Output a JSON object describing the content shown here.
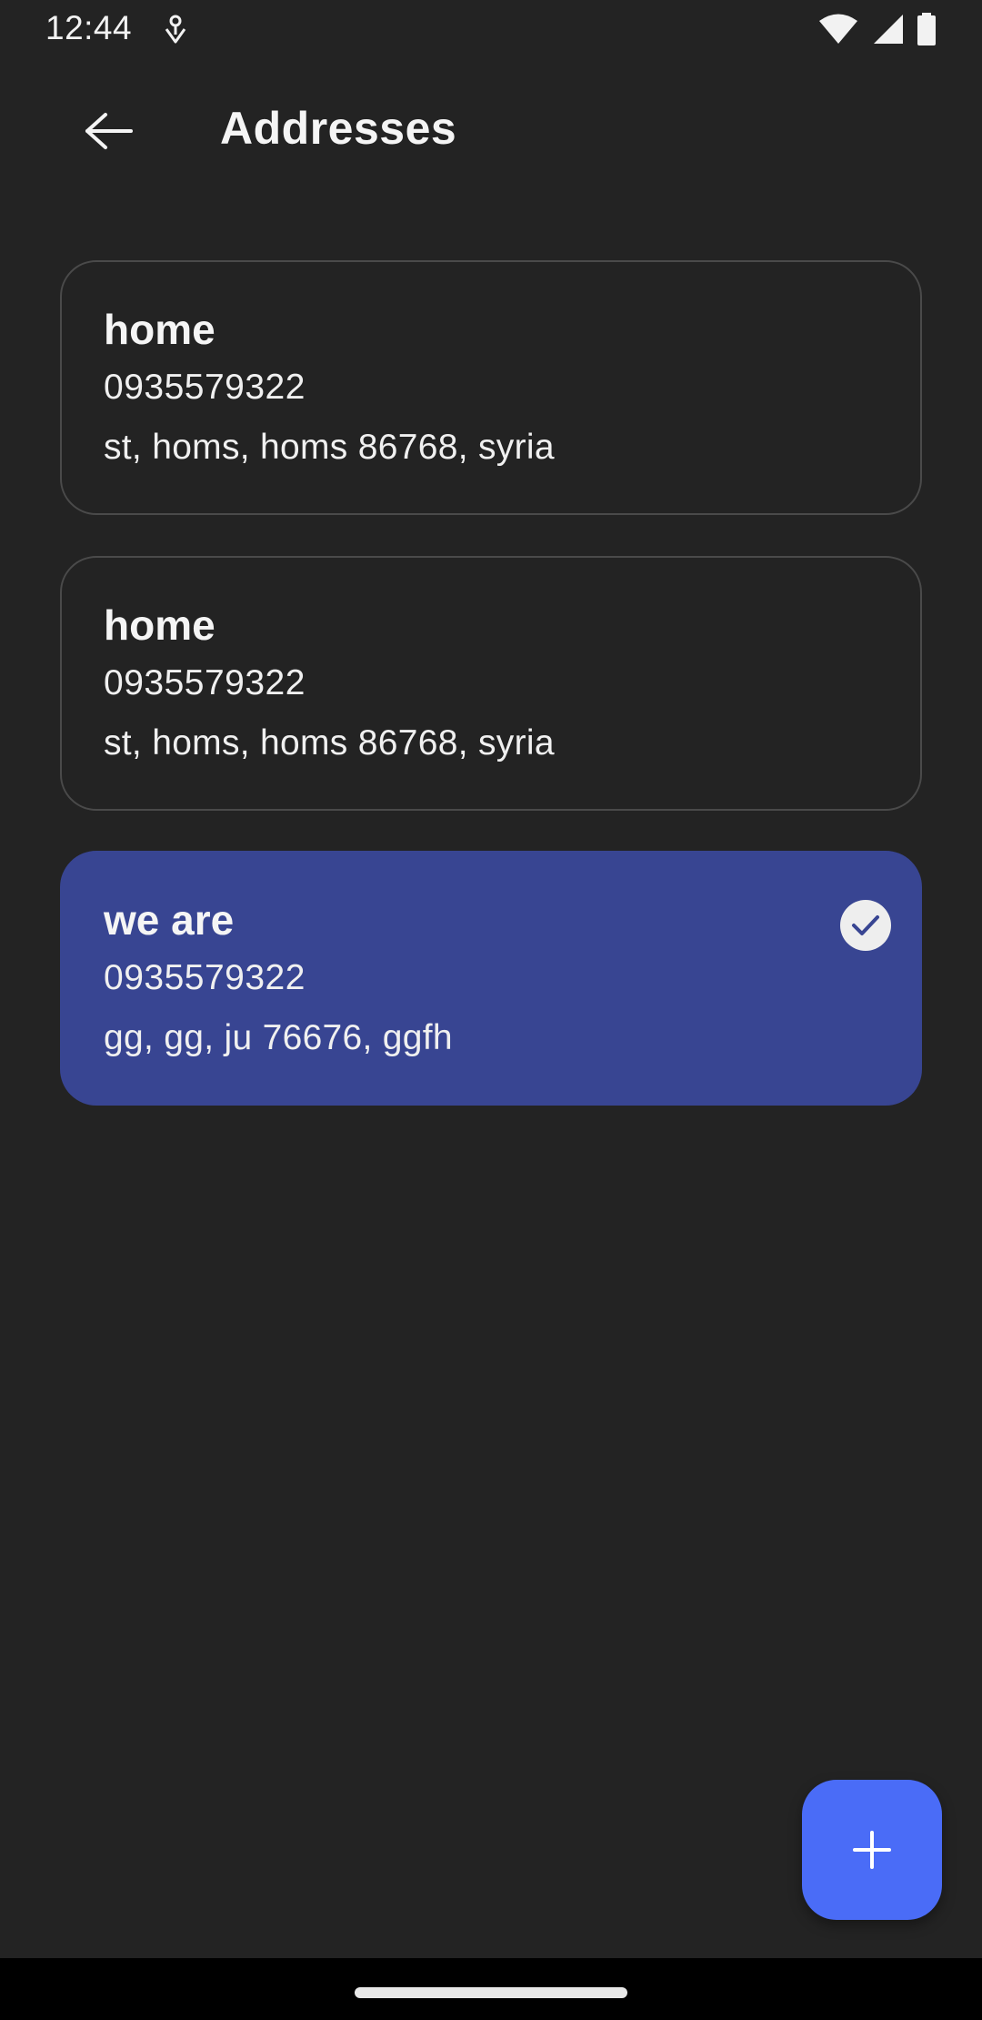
{
  "status_bar": {
    "time": "12:44"
  },
  "header": {
    "title": "Addresses"
  },
  "addresses": [
    {
      "name": "home",
      "phone": "0935579322",
      "address": "st, homs, homs 86768, syria",
      "selected": false
    },
    {
      "name": "home",
      "phone": "0935579322",
      "address": "st, homs, homs 86768, syria",
      "selected": false
    },
    {
      "name": "we are",
      "phone": "0935579322",
      "address": "gg, gg, ju 76676, ggfh",
      "selected": true
    }
  ],
  "colors": {
    "background": "#232323",
    "selected_card": "#384592",
    "fab": "#4a6cf7",
    "card_border": "#4a4a4a"
  },
  "icons": {
    "back": "arrow-left-icon",
    "selected": "check-icon",
    "add": "plus-icon"
  }
}
